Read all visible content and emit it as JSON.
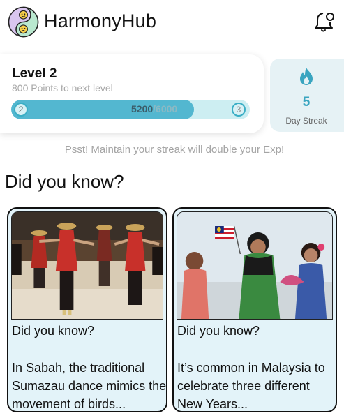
{
  "header": {
    "app_name": "HarmonyHub",
    "logo_icon": "yin-yang-smiley-icon",
    "notification_icon": "bell-icon"
  },
  "level": {
    "title": "Level 2",
    "subtitle": "800 Points to next level",
    "current_level": "2",
    "next_level": "3",
    "points_current": "5200",
    "points_max": "/6000",
    "progress": 0.867
  },
  "streak": {
    "icon": "flame-icon",
    "value": "5",
    "label": "Day Streak"
  },
  "tip": "Psst! Maintain your streak will double your Exp!",
  "section_title": "Did you know?",
  "cards": [
    {
      "heading": "Did you know?",
      "body": "In Sabah, the traditional Sumazau dance mimics the movement of birds...",
      "image": "sumazau-dancers-photo"
    },
    {
      "heading": "Did you know?",
      "body": "It’s common in Malaysia to celebrate three different New Years...",
      "image": "malaysian-women-celebrating-photo"
    }
  ],
  "colors": {
    "accent": "#53b7d0",
    "accent_light": "#cdeef2",
    "card_bg": "#e3f3f9",
    "streak_bg": "#e6f2f5"
  }
}
